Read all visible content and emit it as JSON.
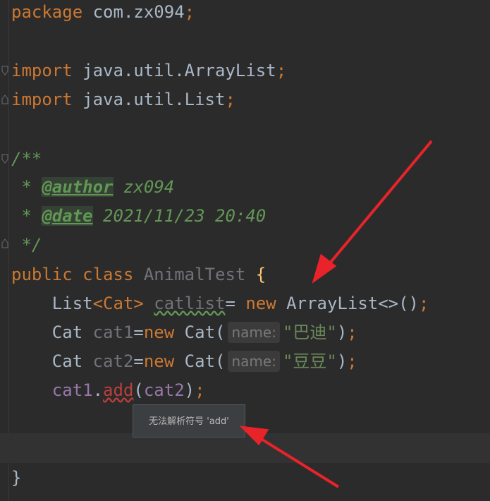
{
  "code": {
    "l1": {
      "kw": "package",
      "rest": " com.zx094",
      "semi": ";"
    },
    "l3": {
      "kw": "import",
      "rest": " java.util.ArrayList",
      "semi": ";"
    },
    "l4": {
      "kw": "import",
      "rest": " java.util.List",
      "semi": ";"
    },
    "l6": {
      "text": "/**"
    },
    "l7": {
      "star": " * ",
      "tag": "@author",
      "val": " zx094"
    },
    "l8": {
      "star": " * ",
      "tag": "@date",
      "val": " 2021/11/23 20:40"
    },
    "l9": {
      "text": " */"
    },
    "l10": {
      "kw1": "public",
      "kw2": " class",
      "cls": " AnimalTest",
      "brace": " {"
    },
    "l11": {
      "type": "    List",
      "gen": "<Cat>",
      "var": "catlist",
      "eq": "= ",
      "kw": "new",
      "rest": " ArrayList<>()",
      "semi": ";"
    },
    "l12": {
      "type": "    Cat",
      "var": " cat1",
      "eq": "=",
      "kw": "new",
      "call": " Cat(",
      "hint": "name:",
      "str": "\"巴迪\"",
      "close": ")",
      "semi": ";"
    },
    "l13": {
      "type": "    Cat",
      "var": " cat2",
      "eq": "=",
      "kw": "new",
      "call": " Cat(",
      "hint": "name:",
      "str": "\"豆豆\"",
      "close": ")",
      "semi": ";"
    },
    "l14": {
      "indent": "    ",
      "obj": "cat1",
      "dot": ".",
      "method": "add",
      "open": "(",
      "arg": "cat2",
      "close": ")",
      "semi": ";"
    },
    "l16": {
      "text": "}"
    }
  },
  "tooltip": {
    "text": "无法解析符号 'add'"
  },
  "colors": {
    "arrow": "#e8232a",
    "background": "#2b2b2b"
  }
}
